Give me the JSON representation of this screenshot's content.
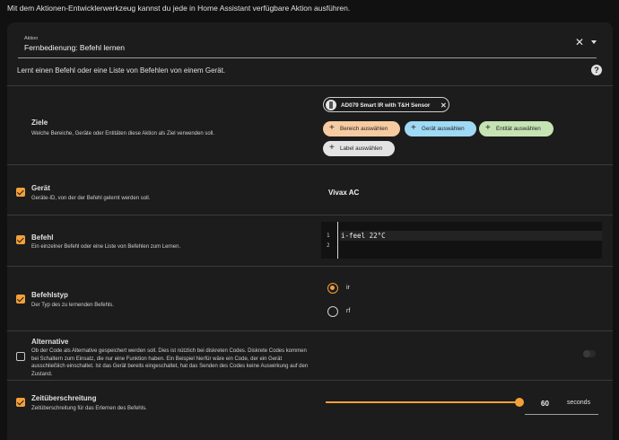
{
  "header": {
    "intro": "Mit dem Aktionen-Entwicklerwerkzeug kannst du jede in Home Assistant verfügbare Aktion ausführen."
  },
  "action": {
    "caption": "Aktion",
    "value": "Fernbedienung: Befehl lernen",
    "clear_glyph": "✕",
    "description": "Lernt einen Befehl oder eine Liste von Befehlen von einem Gerät."
  },
  "icons": {
    "help": "help-circle-icon",
    "clear": "close-icon",
    "dropdown": "menu-down-icon",
    "device": "remote-icon",
    "plus": "plus-icon"
  },
  "targets": {
    "title": "Ziele",
    "description": "Welche Bereiche, Geräte oder Entitäten diese Aktion als Ziel verwenden soll.",
    "selected_device": "AD079 Smart IR with T&H Sensor",
    "remove_glyph": "✕",
    "plus_glyph": "+",
    "buttons": {
      "area": "Bereich auswählen",
      "device": "Gerät auswählen",
      "entity": "Entität auswählen",
      "label": "Label auswählen"
    }
  },
  "fields": {
    "device": {
      "title": "Gerät",
      "description": "Geräte-ID, von der der Befehl gelernt werden soll.",
      "value": "Vivax AC",
      "enabled": true
    },
    "command": {
      "title": "Befehl",
      "description": "Ein einzelner Befehl oder eine Liste von Befehlen zum Lernen.",
      "line_numbers": [
        "1",
        "2"
      ],
      "code": "i-feel 22°C",
      "enabled": true
    },
    "command_type": {
      "title": "Befehlstyp",
      "description": "Der Typ des zu lernenden Befehls.",
      "options": [
        "ir",
        "rf"
      ],
      "selected": "ir",
      "enabled": true
    },
    "alternative": {
      "title": "Alternative",
      "description": "Ob der Code als Alternative gespeichert werden soll. Dies ist nützlich bei diskreten Codes. Diskrete Codes kommen bei Schaltern zum Einsatz, die nur eine Funktion haben. Ein Beispiel hierfür wäre ein Code, der ein Gerät ausschließlich einschaltet. Ist das Gerät bereits eingeschaltet, hat das Senden des Codes keine Auswirkung auf den Zustand.",
      "enabled": false,
      "toggle_on": false
    },
    "timeout": {
      "title": "Zeitüberschreitung",
      "description": "Zeitüberschreitung für das Erlernen des Befehls.",
      "value": "60",
      "unit": "seconds",
      "slider_fraction": 0.98,
      "enabled": true
    }
  },
  "colors": {
    "accent": "#f3a03a",
    "background": "#111111",
    "card": "#1c1c1c",
    "chip_area": "#f7cba2",
    "chip_device": "#9fd9f4",
    "chip_entity": "#c6e3b3",
    "chip_label": "#e3e3e3"
  }
}
